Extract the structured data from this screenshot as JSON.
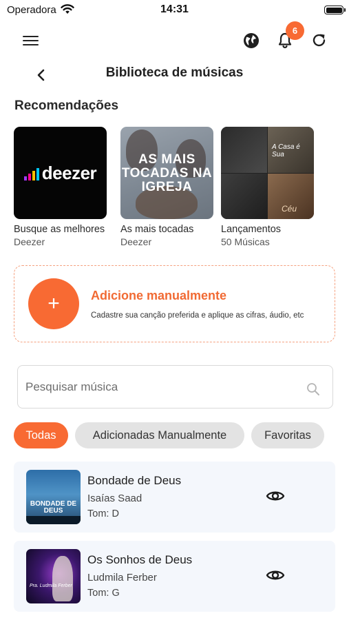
{
  "status_bar": {
    "carrier": "Operadora",
    "time": "14:31",
    "icons": [
      "wifi-icon",
      "battery-icon"
    ]
  },
  "top_bar": {
    "icons": [
      "menu-icon",
      "globe-icon",
      "bell-icon",
      "refresh-icon"
    ],
    "notification_count": "6",
    "accent_color": "#f86a33"
  },
  "header": {
    "title": "Biblioteca de músicas",
    "back_icon": "chevron-left-icon"
  },
  "recommendations": {
    "title": "Recomendações",
    "items": [
      {
        "label": "Busque as melhores",
        "subtitle": "Deezer",
        "cover_text": "deezer"
      },
      {
        "label": "As mais tocadas",
        "subtitle": "Deezer",
        "cover_text": "AS MAIS TOCADAS NA IGREJA"
      },
      {
        "label": "Lançamentos",
        "subtitle": "50 Músicas",
        "cover_text": [
          "A Casa é Sua",
          "Céu"
        ]
      }
    ]
  },
  "add_manual": {
    "title": "Adicione manualmente",
    "description": "Cadastre sua canção preferida e aplique as cifras, áudio, etc",
    "icon": "plus-icon"
  },
  "search": {
    "placeholder": "Pesquisar música",
    "value": "",
    "icon": "search-icon"
  },
  "filters": {
    "items": [
      {
        "label": "Todas",
        "active": true
      },
      {
        "label": "Adicionadas Manualmente",
        "active": false
      },
      {
        "label": "Favoritas",
        "active": false
      }
    ]
  },
  "songs": [
    {
      "title": "Bondade de Deus",
      "artist": "Isaías Saad",
      "tom": "Tom: D",
      "cover_text": "BONDADE DE DEUS"
    },
    {
      "title": "Os Sonhos de Deus",
      "artist": "Ludmila Ferber",
      "tom": "Tom: G",
      "cover_text": "Pra. Ludmila Ferber"
    }
  ]
}
